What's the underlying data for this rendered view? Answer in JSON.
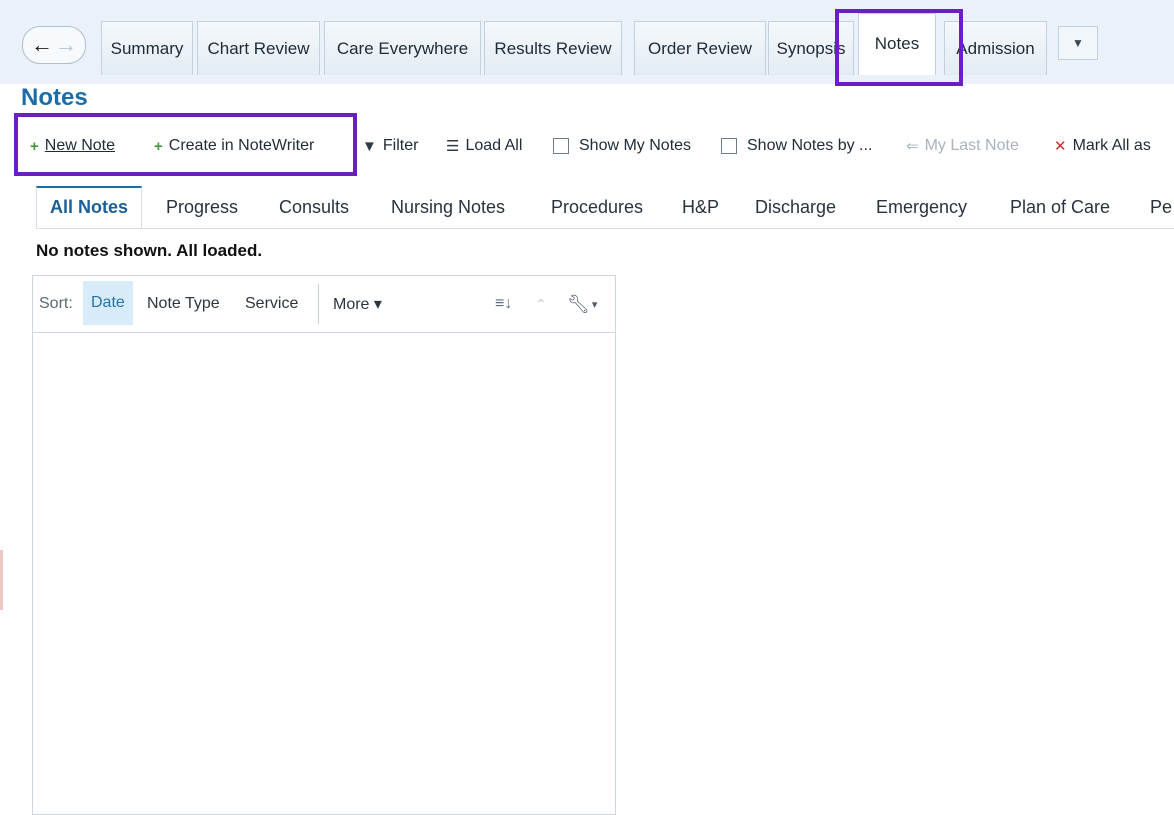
{
  "tabs": [
    {
      "label": "Summary"
    },
    {
      "label": "Chart Review"
    },
    {
      "label": "Care Everywhere"
    },
    {
      "label": "Results Review"
    },
    {
      "label": "Order Review"
    },
    {
      "label": "Synopsis"
    },
    {
      "label": "Notes"
    },
    {
      "label": "Admission"
    }
  ],
  "active_tab": "Notes",
  "icons": {
    "back": "←",
    "forward": "→",
    "more_tabs": "▼"
  },
  "page": {
    "title": "Notes",
    "status": "No notes shown. All loaded."
  },
  "toolbar": {
    "new_note": "New Note",
    "create_in_notewriter": "Create in NoteWriter",
    "filter": "Filter",
    "load_all": "Load All",
    "show_my_notes": "Show My Notes",
    "show_notes_by": "Show Notes by ...",
    "my_last_note": "My Last Note",
    "mark_all_as": "Mark All as"
  },
  "subtabs": [
    {
      "label": "All Notes"
    },
    {
      "label": "Progress"
    },
    {
      "label": "Consults"
    },
    {
      "label": "Nursing Notes"
    },
    {
      "label": "Procedures"
    },
    {
      "label": "H&P"
    },
    {
      "label": "Discharge"
    },
    {
      "label": "Emergency"
    },
    {
      "label": "Plan of Care"
    },
    {
      "label": "Pe"
    }
  ],
  "active_subtab": "All Notes",
  "sortbar": {
    "label": "Sort:",
    "options": [
      "Date",
      "Note Type",
      "Service"
    ],
    "selected": "Date",
    "more": "More ▾"
  },
  "colors": {
    "highlight": "#6a1fc2",
    "title": "#1c6da7"
  }
}
